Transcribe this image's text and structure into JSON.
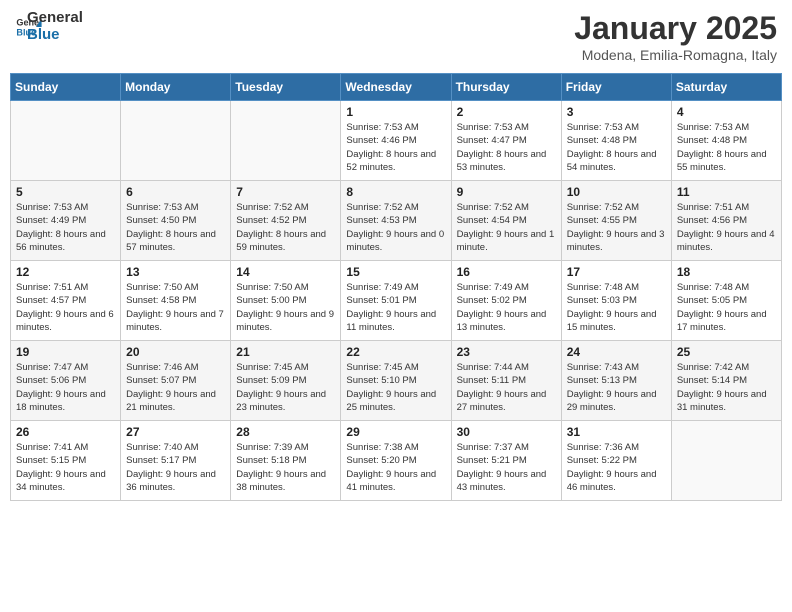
{
  "header": {
    "logo_general": "General",
    "logo_blue": "Blue",
    "title": "January 2025",
    "subtitle": "Modena, Emilia-Romagna, Italy"
  },
  "weekdays": [
    "Sunday",
    "Monday",
    "Tuesday",
    "Wednesday",
    "Thursday",
    "Friday",
    "Saturday"
  ],
  "weeks": [
    [
      {
        "day": "",
        "detail": ""
      },
      {
        "day": "",
        "detail": ""
      },
      {
        "day": "",
        "detail": ""
      },
      {
        "day": "1",
        "detail": "Sunrise: 7:53 AM\nSunset: 4:46 PM\nDaylight: 8 hours and 52 minutes."
      },
      {
        "day": "2",
        "detail": "Sunrise: 7:53 AM\nSunset: 4:47 PM\nDaylight: 8 hours and 53 minutes."
      },
      {
        "day": "3",
        "detail": "Sunrise: 7:53 AM\nSunset: 4:48 PM\nDaylight: 8 hours and 54 minutes."
      },
      {
        "day": "4",
        "detail": "Sunrise: 7:53 AM\nSunset: 4:48 PM\nDaylight: 8 hours and 55 minutes."
      }
    ],
    [
      {
        "day": "5",
        "detail": "Sunrise: 7:53 AM\nSunset: 4:49 PM\nDaylight: 8 hours and 56 minutes."
      },
      {
        "day": "6",
        "detail": "Sunrise: 7:53 AM\nSunset: 4:50 PM\nDaylight: 8 hours and 57 minutes."
      },
      {
        "day": "7",
        "detail": "Sunrise: 7:52 AM\nSunset: 4:52 PM\nDaylight: 8 hours and 59 minutes."
      },
      {
        "day": "8",
        "detail": "Sunrise: 7:52 AM\nSunset: 4:53 PM\nDaylight: 9 hours and 0 minutes."
      },
      {
        "day": "9",
        "detail": "Sunrise: 7:52 AM\nSunset: 4:54 PM\nDaylight: 9 hours and 1 minute."
      },
      {
        "day": "10",
        "detail": "Sunrise: 7:52 AM\nSunset: 4:55 PM\nDaylight: 9 hours and 3 minutes."
      },
      {
        "day": "11",
        "detail": "Sunrise: 7:51 AM\nSunset: 4:56 PM\nDaylight: 9 hours and 4 minutes."
      }
    ],
    [
      {
        "day": "12",
        "detail": "Sunrise: 7:51 AM\nSunset: 4:57 PM\nDaylight: 9 hours and 6 minutes."
      },
      {
        "day": "13",
        "detail": "Sunrise: 7:50 AM\nSunset: 4:58 PM\nDaylight: 9 hours and 7 minutes."
      },
      {
        "day": "14",
        "detail": "Sunrise: 7:50 AM\nSunset: 5:00 PM\nDaylight: 9 hours and 9 minutes."
      },
      {
        "day": "15",
        "detail": "Sunrise: 7:49 AM\nSunset: 5:01 PM\nDaylight: 9 hours and 11 minutes."
      },
      {
        "day": "16",
        "detail": "Sunrise: 7:49 AM\nSunset: 5:02 PM\nDaylight: 9 hours and 13 minutes."
      },
      {
        "day": "17",
        "detail": "Sunrise: 7:48 AM\nSunset: 5:03 PM\nDaylight: 9 hours and 15 minutes."
      },
      {
        "day": "18",
        "detail": "Sunrise: 7:48 AM\nSunset: 5:05 PM\nDaylight: 9 hours and 17 minutes."
      }
    ],
    [
      {
        "day": "19",
        "detail": "Sunrise: 7:47 AM\nSunset: 5:06 PM\nDaylight: 9 hours and 18 minutes."
      },
      {
        "day": "20",
        "detail": "Sunrise: 7:46 AM\nSunset: 5:07 PM\nDaylight: 9 hours and 21 minutes."
      },
      {
        "day": "21",
        "detail": "Sunrise: 7:45 AM\nSunset: 5:09 PM\nDaylight: 9 hours and 23 minutes."
      },
      {
        "day": "22",
        "detail": "Sunrise: 7:45 AM\nSunset: 5:10 PM\nDaylight: 9 hours and 25 minutes."
      },
      {
        "day": "23",
        "detail": "Sunrise: 7:44 AM\nSunset: 5:11 PM\nDaylight: 9 hours and 27 minutes."
      },
      {
        "day": "24",
        "detail": "Sunrise: 7:43 AM\nSunset: 5:13 PM\nDaylight: 9 hours and 29 minutes."
      },
      {
        "day": "25",
        "detail": "Sunrise: 7:42 AM\nSunset: 5:14 PM\nDaylight: 9 hours and 31 minutes."
      }
    ],
    [
      {
        "day": "26",
        "detail": "Sunrise: 7:41 AM\nSunset: 5:15 PM\nDaylight: 9 hours and 34 minutes."
      },
      {
        "day": "27",
        "detail": "Sunrise: 7:40 AM\nSunset: 5:17 PM\nDaylight: 9 hours and 36 minutes."
      },
      {
        "day": "28",
        "detail": "Sunrise: 7:39 AM\nSunset: 5:18 PM\nDaylight: 9 hours and 38 minutes."
      },
      {
        "day": "29",
        "detail": "Sunrise: 7:38 AM\nSunset: 5:20 PM\nDaylight: 9 hours and 41 minutes."
      },
      {
        "day": "30",
        "detail": "Sunrise: 7:37 AM\nSunset: 5:21 PM\nDaylight: 9 hours and 43 minutes."
      },
      {
        "day": "31",
        "detail": "Sunrise: 7:36 AM\nSunset: 5:22 PM\nDaylight: 9 hours and 46 minutes."
      },
      {
        "day": "",
        "detail": ""
      }
    ]
  ]
}
